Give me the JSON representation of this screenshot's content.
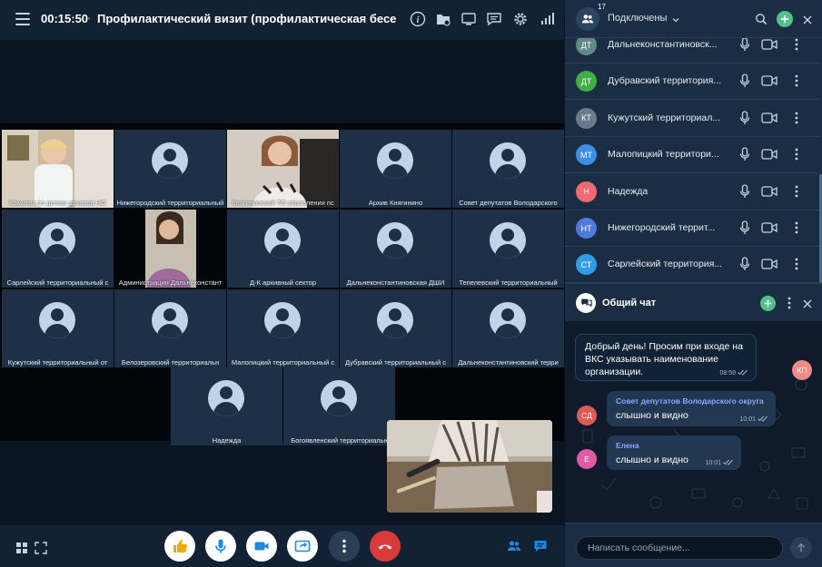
{
  "topbar": {
    "timer": "00:15:50",
    "separator": "·",
    "title": "Профилактический визит (профилактическая бесе...",
    "icons": [
      "info-icon",
      "folder-icon",
      "screen-icon",
      "chat-bubble-icon",
      "gear-icon",
      "signal-icon"
    ]
  },
  "tiles": [
    {
      "label": "Комитет по делам архивов НО",
      "video": true
    },
    {
      "label": "Нижегородский территориальный",
      "video": false
    },
    {
      "label": "Княгининский ТО управления пс",
      "video": true
    },
    {
      "label": "Архив Княгинино",
      "video": false
    },
    {
      "label": "Совет депутатов Володарского",
      "video": false
    },
    {
      "label": "Сарлейский территориальный с",
      "video": false
    },
    {
      "label": "Администрация Дальнеконстант",
      "video": true
    },
    {
      "label": "Д-К архивный сектор",
      "video": false
    },
    {
      "label": "Дальнеконстантиновская ДШИ",
      "video": false
    },
    {
      "label": "Тепелевский территориальный",
      "video": false
    },
    {
      "label": "Кужутский территориальный от",
      "video": false
    },
    {
      "label": "Белозеровский территориальн",
      "video": false
    },
    {
      "label": "Малопицкий территориальный с",
      "video": false
    },
    {
      "label": "Дубравский территориальный с",
      "video": false
    },
    {
      "label": "Дальнеконстантиновский терри",
      "video": false
    },
    {
      "label": "Надежда",
      "video": false
    },
    {
      "label": "Богоявленский территориальн",
      "video": false
    }
  ],
  "controls": {
    "like": "thumbs-up-icon",
    "mic": "microphone-icon",
    "camera": "camera-icon",
    "share": "share-screen-icon",
    "more": "more-icon",
    "hangup": "hangup-icon"
  },
  "panel": {
    "participant_count": "17",
    "status": "Подключены",
    "participants": [
      {
        "initials": "ДТ",
        "name": "Дальнеконстантиновск...",
        "color": "#5f8a87"
      },
      {
        "initials": "ДТ",
        "name": "Дубравский территория...",
        "color": "#3fae45"
      },
      {
        "initials": "КТ",
        "name": "Кужутский территориал...",
        "color": "#6b7b8c"
      },
      {
        "initials": "МТ",
        "name": "Малопицкий территори...",
        "color": "#3e8ee8"
      },
      {
        "initials": "Н",
        "name": "Надежда",
        "color": "#f06a76"
      },
      {
        "initials": "НТ",
        "name": "Нижегородский террит...",
        "color": "#4f7be0"
      },
      {
        "initials": "СТ",
        "name": "Сарлейский территория...",
        "color": "#2f9ee8"
      }
    ]
  },
  "chat": {
    "title": "Общий чат",
    "input_placeholder": "Написать сообщение...",
    "messages": [
      {
        "avatar": "КП",
        "avatar_color": "#f08a8a",
        "sender": "",
        "text": "Добрый день! Просим при входе на ВКС указывать наименование организации.",
        "time": "08:59"
      },
      {
        "avatar": "СД",
        "avatar_color": "#e05a55",
        "sender": "Совет депутатов Володарского округа",
        "text": "слышно и видно",
        "time": "10:01"
      },
      {
        "avatar": "Е",
        "avatar_color": "#e05aa8",
        "sender": "Елена",
        "text": "слышно и видно",
        "time": "10:01"
      }
    ]
  },
  "colors": {
    "accent_green": "#4fc18a",
    "hangup_red": "#d93a3a",
    "link_blue": "#1e88e5"
  }
}
